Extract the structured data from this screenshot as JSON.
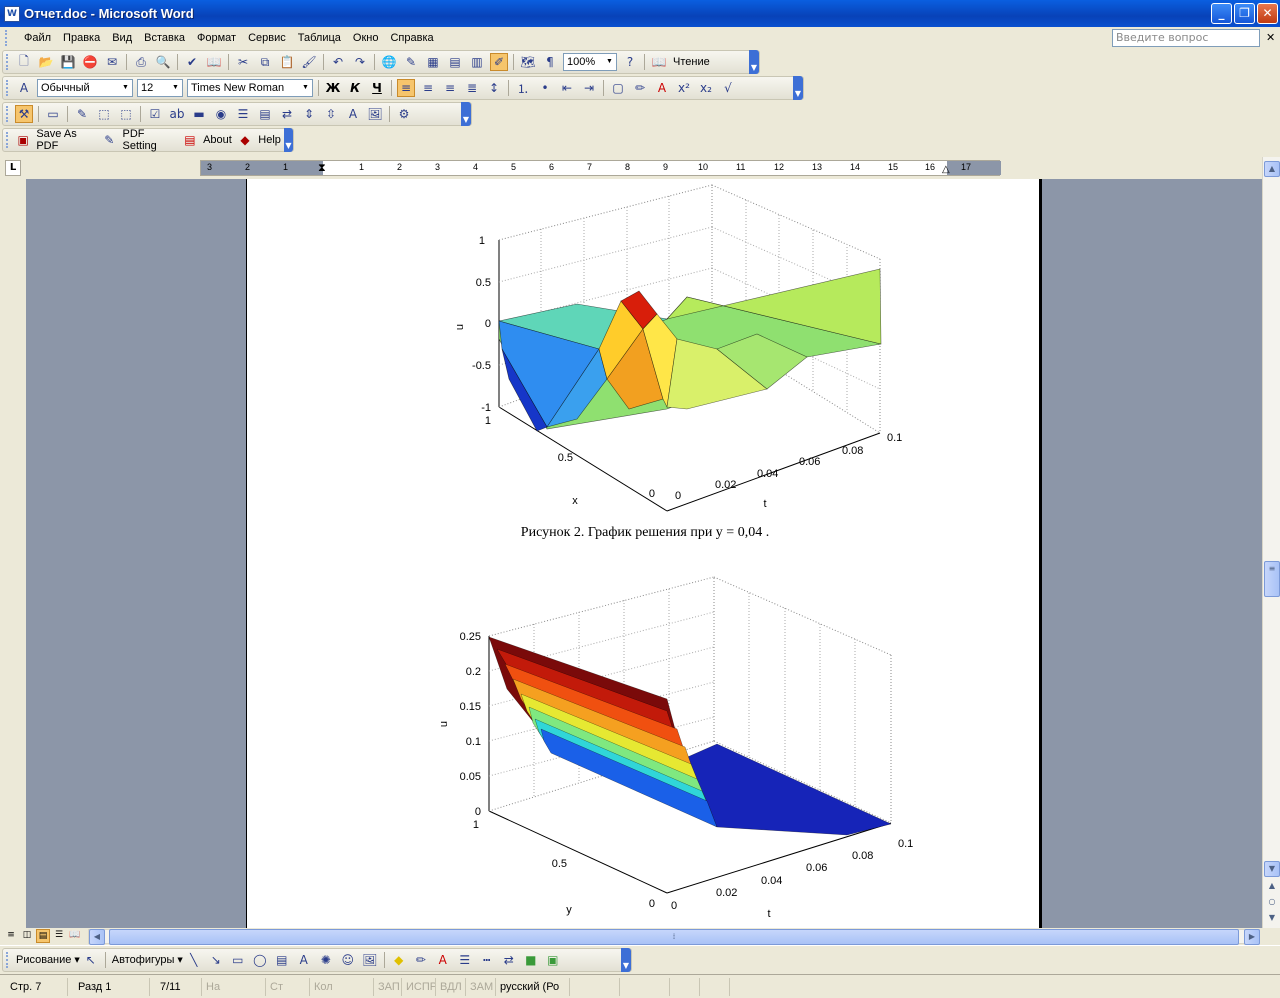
{
  "window": {
    "title": "Отчет.doc - Microsoft Word",
    "app_icon": "W"
  },
  "menu": [
    "Файл",
    "Правка",
    "Вид",
    "Вставка",
    "Формат",
    "Сервис",
    "Таблица",
    "Окно",
    "Справка"
  ],
  "help_search": {
    "placeholder": "Введите вопрос"
  },
  "standard_toolbar": {
    "zoom": "100%",
    "read_label": "Чтение"
  },
  "formatting_toolbar": {
    "style": "Обычный",
    "font_size": "12",
    "font": "Times New Roman",
    "bold": "Ж",
    "italic": "К",
    "underline": "Ч"
  },
  "pdf_toolbar": {
    "save_pdf": "Save As PDF",
    "pdf_setting": "PDF Setting",
    "about": "About",
    "help": "Help"
  },
  "ruler": {
    "numbers": [
      "3",
      "2",
      "1",
      "1",
      "2",
      "3",
      "4",
      "5",
      "6",
      "7",
      "8",
      "9",
      "10",
      "11",
      "12",
      "13",
      "14",
      "15",
      "16",
      "17"
    ]
  },
  "document": {
    "caption1": "Рисунок 2. График решения при  y = 0,04 ."
  },
  "figure1": {
    "zlabel": "u",
    "xlabel": "x",
    "tlabel": "t",
    "z_ticks": [
      "1",
      "0.5",
      "0",
      "-0.5",
      "-1"
    ],
    "x_ticks": [
      "1",
      "0.5",
      "0"
    ],
    "t_ticks": [
      "0",
      "0.02",
      "0.04",
      "0.06",
      "0.08",
      "0.1"
    ]
  },
  "figure2": {
    "zlabel": "u",
    "ylabel": "y",
    "tlabel": "t",
    "z_ticks": [
      "0.25",
      "0.2",
      "0.15",
      "0.1",
      "0.05",
      "0"
    ],
    "y_ticks": [
      "1",
      "0.5",
      "0"
    ],
    "t_ticks": [
      "0",
      "0.02",
      "0.04",
      "0.06",
      "0.08",
      "0.1"
    ]
  },
  "drawing_toolbar": {
    "draw": "Рисование",
    "autoshapes": "Автофигуры"
  },
  "status": {
    "page": "Стр. 7",
    "section": "Разд 1",
    "pages": "7/11",
    "at": "На",
    "line": "Ст",
    "col": "Кол",
    "rec": "ЗАП",
    "trk": "ИСПР",
    "ext": "ВДЛ",
    "ovr": "ЗАМ",
    "language": "русский (Ро"
  },
  "colors": {
    "title_bar": "#0842b8",
    "workspace": "#8c96a8",
    "toolbar": "#ece9d8"
  }
}
